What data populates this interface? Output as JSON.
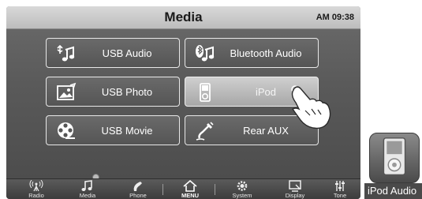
{
  "header": {
    "title": "Media",
    "clock": "AM 09:38"
  },
  "tiles": [
    {
      "label": "USB Audio",
      "icon": "usb-music-icon",
      "selected": false
    },
    {
      "label": "Bluetooth Audio",
      "icon": "bluetooth-music-icon",
      "selected": false
    },
    {
      "label": "USB Photo",
      "icon": "photo-icon",
      "selected": false
    },
    {
      "label": "iPod",
      "icon": "ipod-icon",
      "selected": true
    },
    {
      "label": "USB Movie",
      "icon": "film-reel-icon",
      "selected": false
    },
    {
      "label": "Rear AUX",
      "icon": "aux-cable-icon",
      "selected": false
    }
  ],
  "dock": [
    {
      "label": "Radio",
      "icon": "antenna-icon"
    },
    {
      "label": "Media",
      "icon": "music-note-icon"
    },
    {
      "label": "Phone",
      "icon": "phone-icon"
    },
    {
      "label": "MENU",
      "icon": "home-icon"
    },
    {
      "label": "System",
      "icon": "gear-icon"
    },
    {
      "label": "Display",
      "icon": "display-icon"
    },
    {
      "label": "Tone",
      "icon": "equalizer-icon"
    }
  ],
  "app_icon": {
    "label": "iPod Audio",
    "icon": "ipod-icon"
  },
  "colors": {
    "header_bg": "#c9c9c9",
    "screen_bg": "#5a5a5a",
    "tile_border": "#e8e8e8",
    "selected_tile": "#b8b8b8"
  }
}
